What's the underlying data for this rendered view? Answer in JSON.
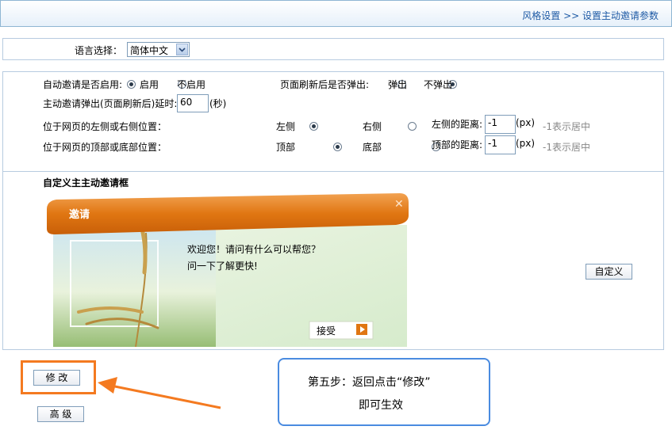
{
  "breadcrumb": "风格设置 >> 设置主动邀请参数",
  "language": {
    "label": "语言选择：",
    "value": "简体中文"
  },
  "auto_invite": {
    "label": "自动邀请是否启用:",
    "enable": "启用",
    "disable": "不启用",
    "refresh_label": "页面刷新后是否弹出:",
    "popup": "弹出",
    "no_popup": "不弹出",
    "delay_label": "主动邀请弹出(页面刷新后)延时:",
    "delay_value": "60",
    "delay_unit": "(秒)"
  },
  "position": {
    "lr_label": "位于网页的左侧或右侧位置：",
    "left": "左侧",
    "right": "右侧",
    "left_dist_label": "左侧的距离:",
    "left_dist_value": "-1",
    "px": "(px)",
    "hint": "-1表示居中",
    "tb_label": "位于网页的顶部或底部位置：",
    "top": "顶部",
    "bottom": "底部",
    "top_dist_label": "顶部的距离:",
    "top_dist_value": "-1"
  },
  "custom": {
    "title": "自定义主主动邀请框",
    "invite_title": "邀请",
    "welcome": "欢迎您！请问有什么可以帮您？",
    "ask": "问一下了解更快!",
    "accept": "接受",
    "custom_button": "自定义"
  },
  "buttons": {
    "modify": "修 改",
    "advanced": "高 级"
  },
  "callout": {
    "line1": "第五步：返回点击“修改”",
    "line2": "即可生效"
  },
  "colors": {
    "accent": "#f47a20",
    "invite_orange": "#e07612",
    "link_blue": "#1e5aa5"
  }
}
